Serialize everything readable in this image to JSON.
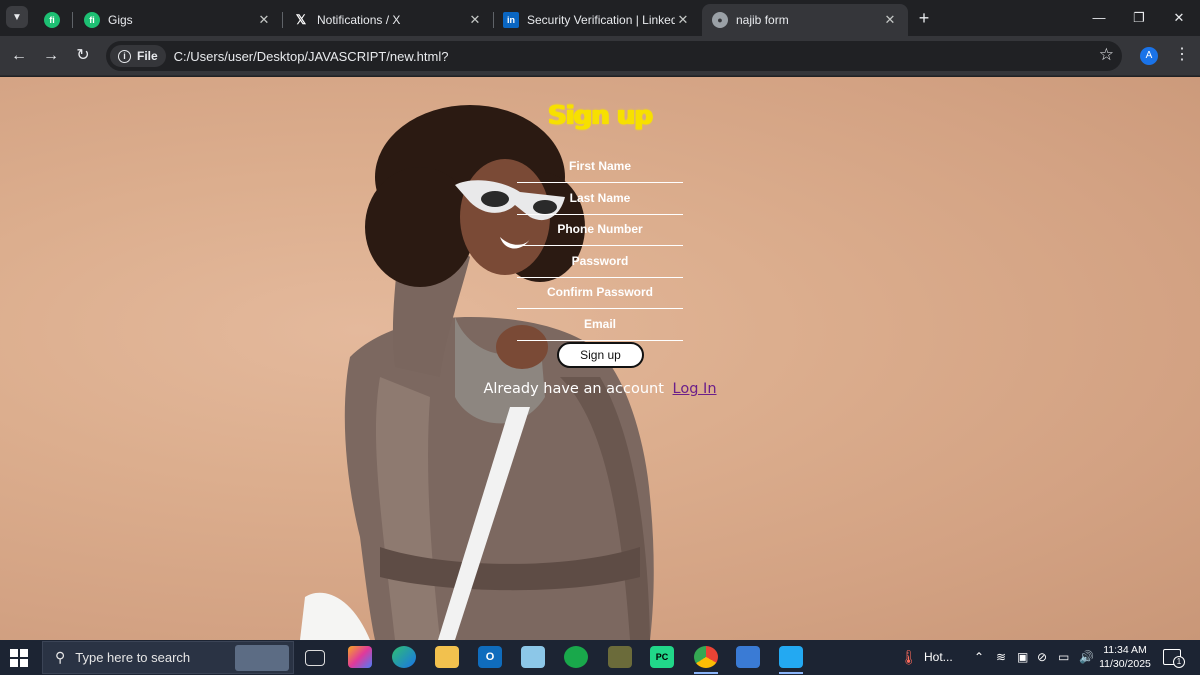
{
  "browser": {
    "tabs": [
      {
        "label": "",
        "icon": "fiverr-icon",
        "active": false
      },
      {
        "label": "Gigs",
        "icon": "fiverr-icon",
        "active": false
      },
      {
        "label": "Notifications / X",
        "icon": "x-icon",
        "active": false
      },
      {
        "label": "Security Verification | LinkedIn",
        "icon": "linkedin-icon",
        "active": false
      },
      {
        "label": "najib form",
        "icon": "globe-icon",
        "active": true
      }
    ],
    "site_chip": "File",
    "url": "C:/Users/user/Desktop/JAVASCRIPT/new.html?",
    "profile_initial": "A"
  },
  "form": {
    "title": "Sign up",
    "fields": [
      {
        "label": "First Name"
      },
      {
        "label": "Last Name"
      },
      {
        "label": "Phone Number"
      },
      {
        "label": "Password"
      },
      {
        "label": "Confirm Password"
      },
      {
        "label": "Email"
      }
    ],
    "submit_label": "Sign up",
    "login_prompt": "Already have an account",
    "login_link": "Log In"
  },
  "taskbar": {
    "search_placeholder": "Type here to search",
    "weather_text": "Hot...",
    "time": "11:34 AM",
    "date": "11/30/2025",
    "notification_count": "1"
  },
  "colors": {
    "title_yellow": "#f7e000",
    "link_purple": "#6b1f8a",
    "page_background": "#d8a98a"
  }
}
